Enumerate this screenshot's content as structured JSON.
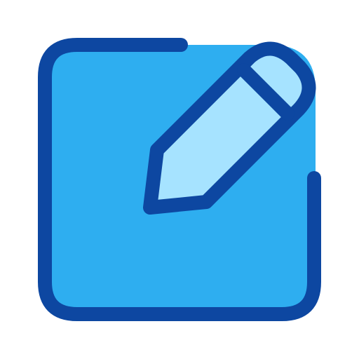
{
  "icon": {
    "name": "edit-icon",
    "colors": {
      "fill_primary": "#2EAEF0",
      "fill_light": "#A6E3FF",
      "outline": "#0D47A1",
      "background": "#FFFFFF"
    }
  }
}
